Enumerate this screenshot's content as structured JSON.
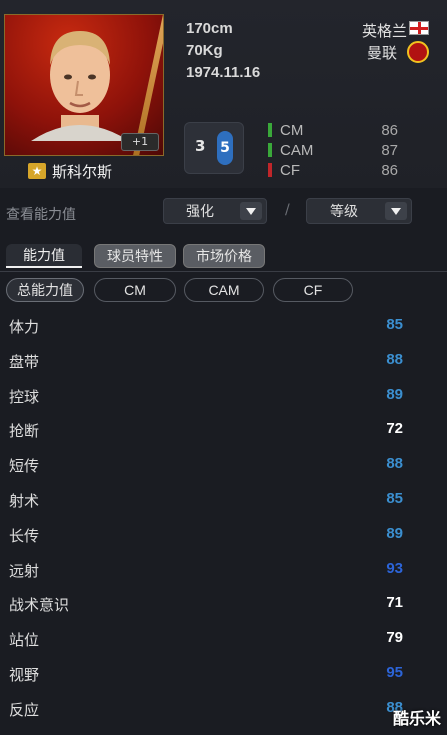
{
  "player": {
    "name": "斯科尔斯",
    "boost_badge": "+1",
    "height": "170cm",
    "weight": "70Kg",
    "birthdate": "1974.11.16",
    "nation": "英格兰",
    "club": "曼联",
    "weak_foot": "3",
    "strong_foot": "5"
  },
  "positions": [
    {
      "name": "CM",
      "rating": "86",
      "color": "#3aa83a"
    },
    {
      "name": "CAM",
      "rating": "87",
      "color": "#3aa83a"
    },
    {
      "name": "CF",
      "rating": "86",
      "color": "#c0262a"
    }
  ],
  "view": {
    "label": "查看能力值",
    "enhance": "强化",
    "level": "等级",
    "separator": "/"
  },
  "tabs": [
    {
      "label": "能力值"
    },
    {
      "label": "球员特性"
    },
    {
      "label": "市场价格"
    }
  ],
  "subtabs": [
    {
      "label": "总能力值"
    },
    {
      "label": "CM"
    },
    {
      "label": "CAM"
    },
    {
      "label": "CF"
    }
  ],
  "stats": [
    {
      "label": "体力",
      "value": "85",
      "color": "#3b8fd0"
    },
    {
      "label": "盘带",
      "value": "88",
      "color": "#3b8fd0"
    },
    {
      "label": "控球",
      "value": "89",
      "color": "#3b8fd0"
    },
    {
      "label": "抢断",
      "value": "72",
      "color": "#ffffff"
    },
    {
      "label": "短传",
      "value": "88",
      "color": "#3b8fd0"
    },
    {
      "label": "射术",
      "value": "85",
      "color": "#3b8fd0"
    },
    {
      "label": "长传",
      "value": "89",
      "color": "#3b8fd0"
    },
    {
      "label": "远射",
      "value": "93",
      "color": "#2c64d8"
    },
    {
      "label": "战术意识",
      "value": "71",
      "color": "#ffffff"
    },
    {
      "label": "站位",
      "value": "79",
      "color": "#ffffff"
    },
    {
      "label": "视野",
      "value": "95",
      "color": "#2c64d8"
    },
    {
      "label": "反应",
      "value": "88",
      "color": "#3b8fd0"
    }
  ],
  "watermark": "酷乐米"
}
